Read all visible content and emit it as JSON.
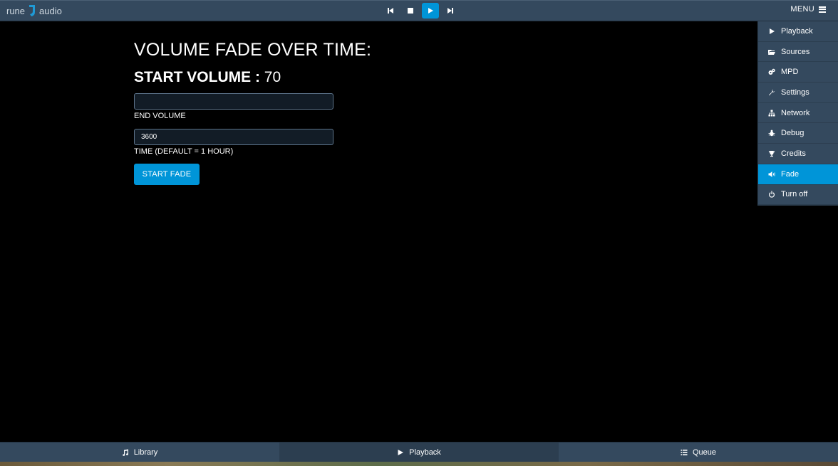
{
  "header": {
    "logo_left": "rune",
    "logo_right": "audio",
    "menu_label": "MENU",
    "transport": [
      {
        "name": "previous-icon",
        "active": false
      },
      {
        "name": "stop-icon",
        "active": false
      },
      {
        "name": "play-icon",
        "active": true
      },
      {
        "name": "next-icon",
        "active": false
      }
    ]
  },
  "menu": {
    "items": [
      {
        "label": "Playback",
        "icon": "play-icon",
        "active": false
      },
      {
        "label": "Sources",
        "icon": "folder-open-icon",
        "active": false
      },
      {
        "label": "MPD",
        "icon": "cogs-icon",
        "active": false
      },
      {
        "label": "Settings",
        "icon": "wrench-icon",
        "active": false
      },
      {
        "label": "Network",
        "icon": "sitemap-icon",
        "active": false
      },
      {
        "label": "Debug",
        "icon": "bug-icon",
        "active": false
      },
      {
        "label": "Credits",
        "icon": "trophy-icon",
        "active": false
      },
      {
        "label": "Fade",
        "icon": "volume-icon",
        "active": true
      },
      {
        "label": "Turn off",
        "icon": "power-icon",
        "active": false
      }
    ]
  },
  "fade": {
    "title": "VOLUME FADE OVER TIME:",
    "start_label": "START VOLUME :",
    "start_value": "70",
    "end_volume_value": "",
    "end_volume_label": "END VOLUME",
    "time_value": "3600",
    "time_label": "TIME (DEFAULT = 1 HOUR)",
    "button_label": "START FADE"
  },
  "footer": {
    "library": "Library",
    "playback": "Playback",
    "queue": "Queue",
    "active": "playback"
  },
  "colors": {
    "bar": "#34495e",
    "accent": "#0095d8",
    "background": "#000000"
  }
}
